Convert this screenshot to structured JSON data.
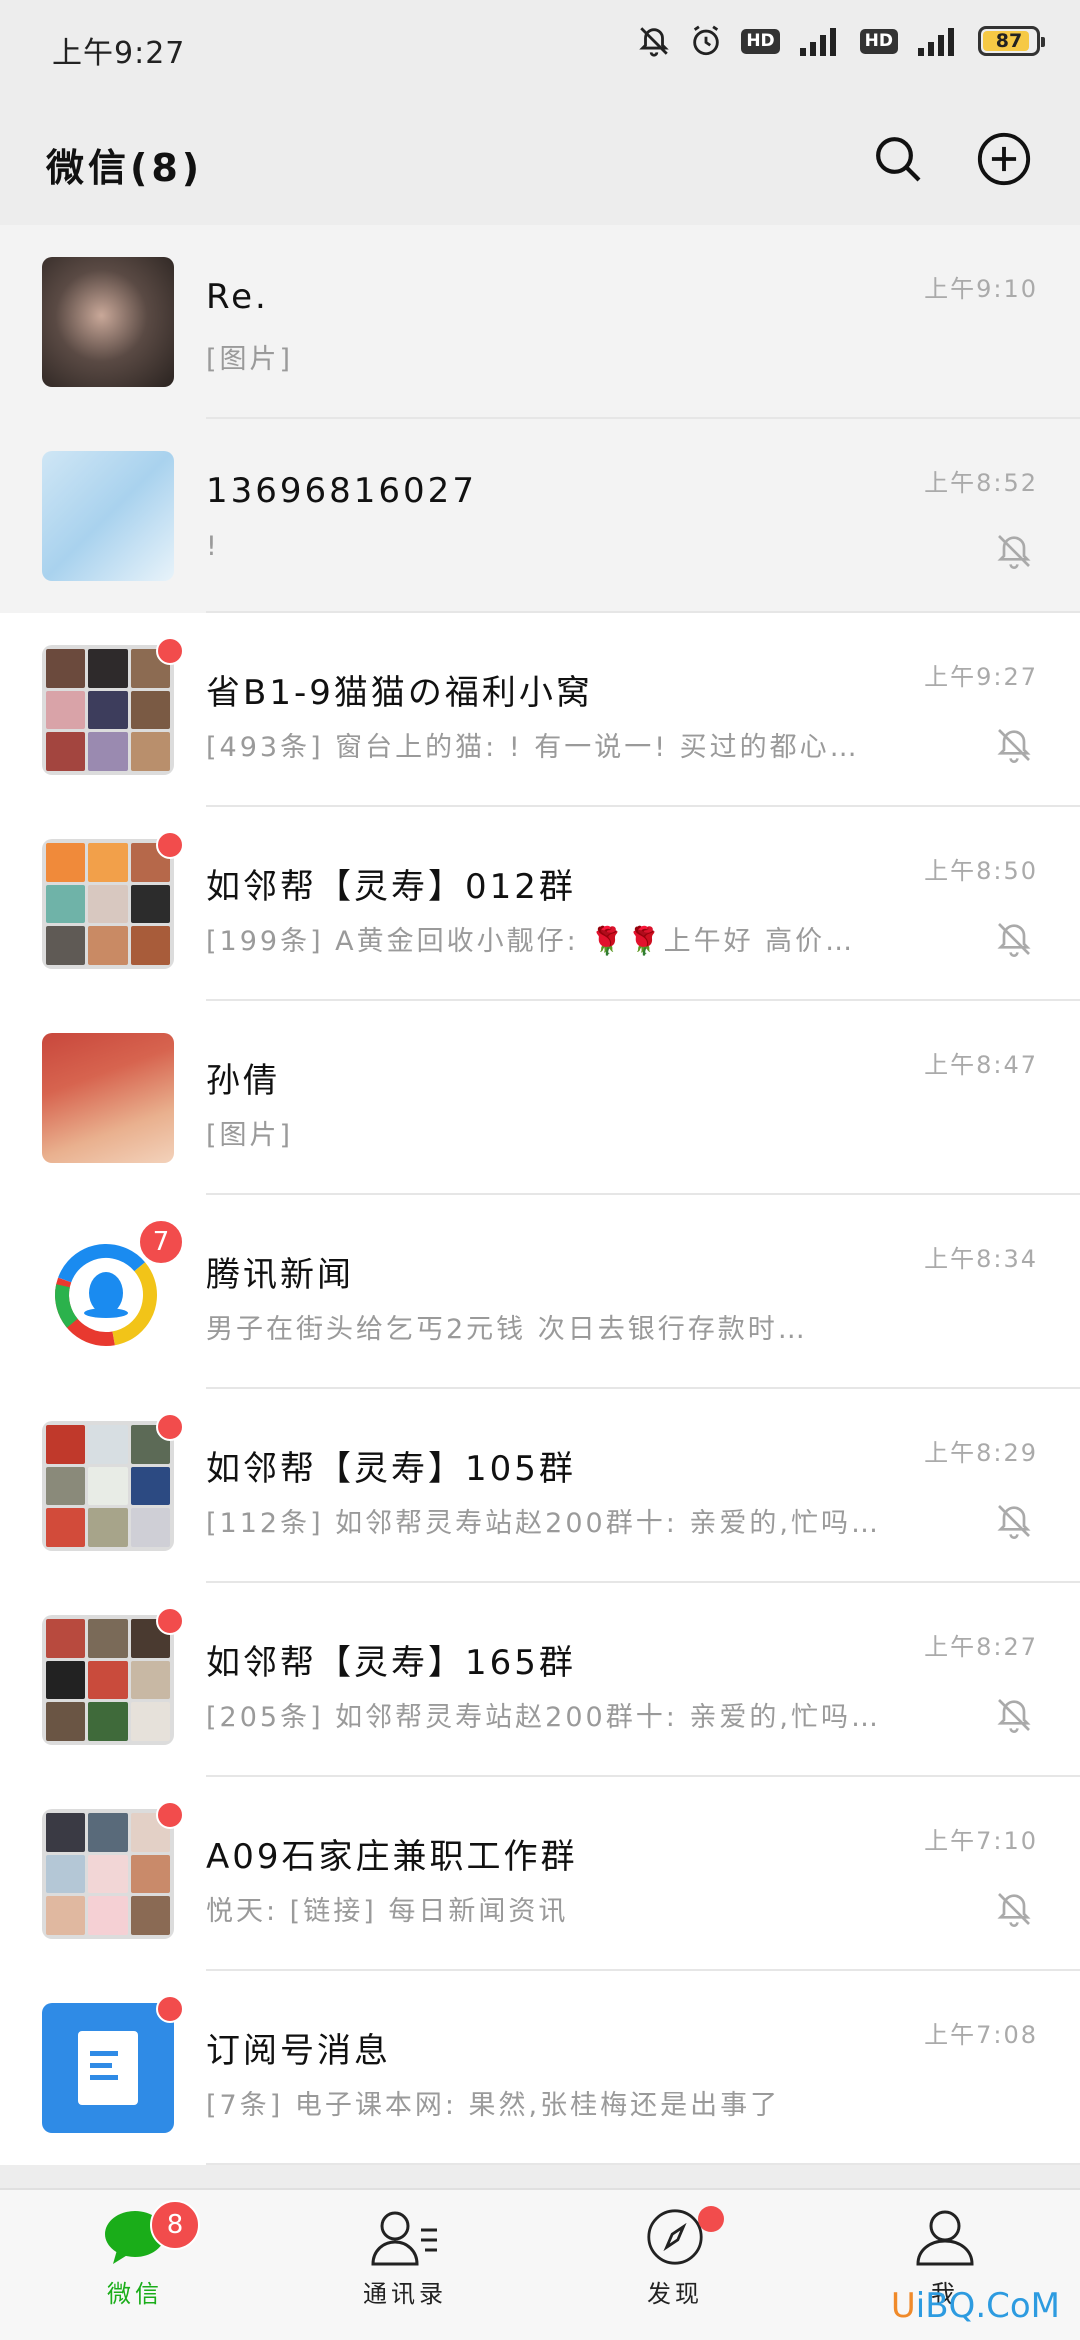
{
  "status_bar": {
    "time": "上午9:27",
    "battery": "87"
  },
  "header": {
    "title": "微信(8)"
  },
  "chats": [
    {
      "name": "Re.",
      "preview": "[图片]",
      "time": "上午9:10",
      "muted": false
    },
    {
      "name": "13696816027",
      "preview": "!",
      "time": "上午8:52",
      "muted": true
    },
    {
      "name": "省B1-9猫猫の福利小窝",
      "preview": "[493条] 窗台上的猫: ! 有一说一! 买过的都心…",
      "time": "上午9:27",
      "muted": true
    },
    {
      "name": "如邻帮【灵寿】012群",
      "preview": "[199条] A黄金回收小靓仔: 🌹🌹上午好  高价…",
      "time": "上午8:50",
      "muted": true
    },
    {
      "name": "孙倩",
      "preview": "[图片]",
      "time": "上午8:47",
      "muted": false
    },
    {
      "name": "腾讯新闻",
      "preview": "男子在街头给乞丐2元钱 次日去银行存款时…",
      "time": "上午8:34",
      "muted": false,
      "badge": "7"
    },
    {
      "name": "如邻帮【灵寿】105群",
      "preview": "[112条] 如邻帮灵寿站赵200群十: 亲爱的,忙吗…",
      "time": "上午8:29",
      "muted": true
    },
    {
      "name": "如邻帮【灵寿】165群",
      "preview": "[205条] 如邻帮灵寿站赵200群十: 亲爱的,忙吗…",
      "time": "上午8:27",
      "muted": true
    },
    {
      "name": "A09石家庄兼职工作群",
      "preview": "悦天: [链接] 每日新闻资讯",
      "time": "上午7:10",
      "muted": true
    },
    {
      "name": "订阅号消息",
      "preview": "[7条] 电子课本网: 果然,张桂梅还是出事了",
      "time": "上午7:08",
      "muted": false
    }
  ],
  "tabs": [
    {
      "label": "微信",
      "badge": "8"
    },
    {
      "label": "通讯录"
    },
    {
      "label": "发现"
    },
    {
      "label": "我"
    }
  ],
  "watermark": {
    "prefix": "U",
    "rest": "iBQ.CoM"
  },
  "colors": {
    "accent": "#1aad19",
    "badge": "#f24c4c",
    "background": "#ededed"
  }
}
